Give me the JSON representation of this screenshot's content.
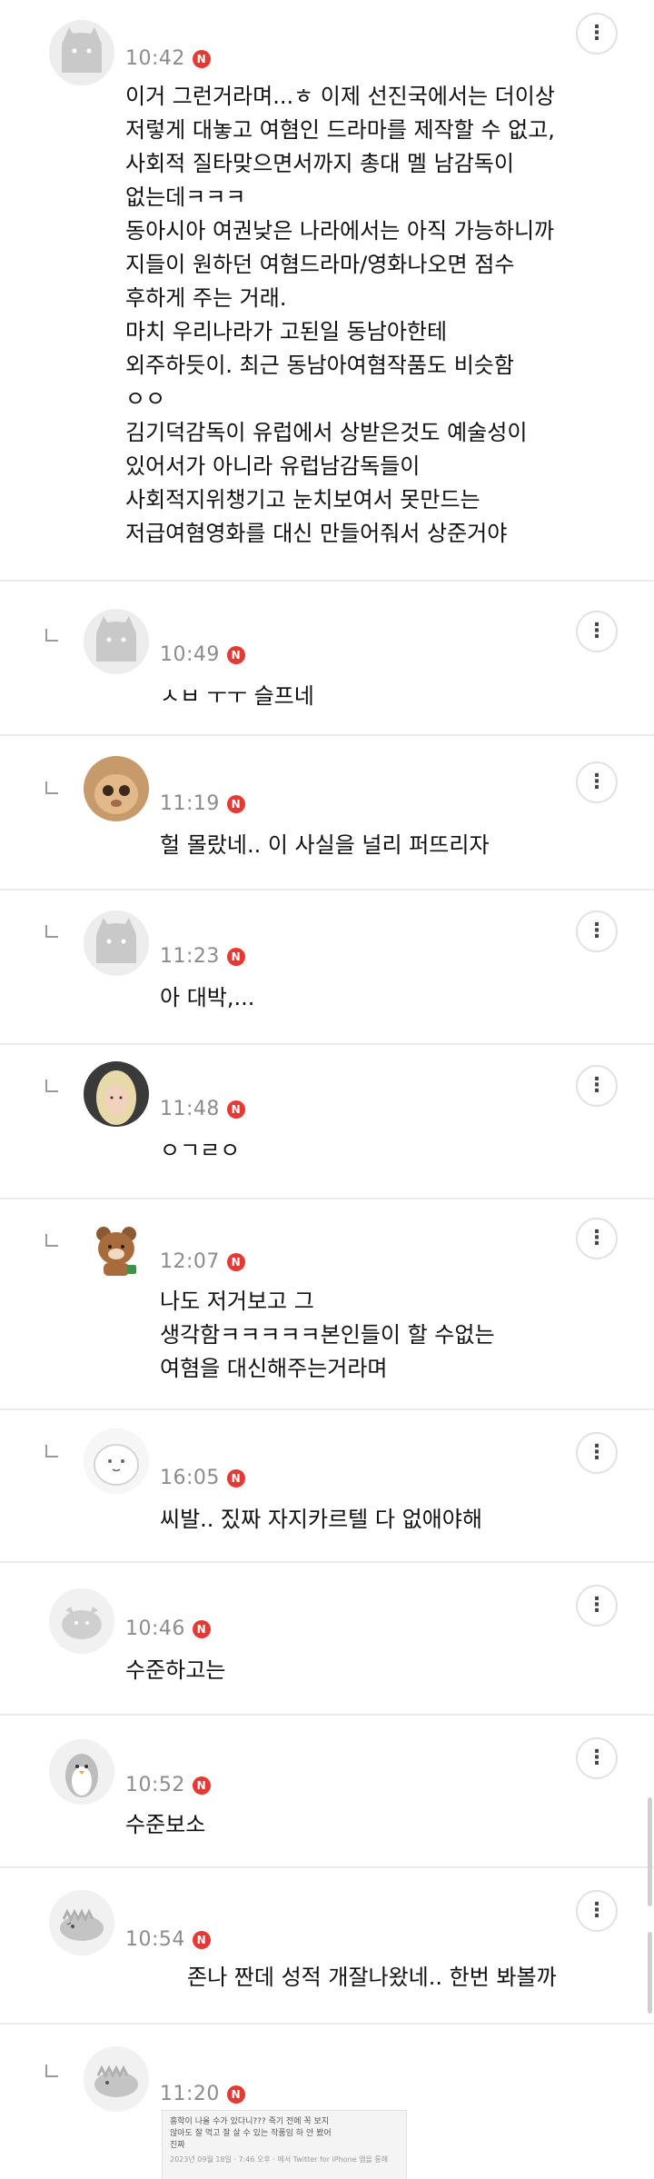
{
  "comments": [
    {
      "time": "10:42",
      "avatar": "cat-ghost-avatar",
      "text": "이거 그런거라며...ㅎ 이제 선진국에서는 더이상\n저렇게 대놓고 여혐인 드라마를 제작할 수 없고,\n사회적 질타맞으면서까지 총대 멜 남감독이\n없는데ㅋㅋㅋ\n동아시아 여권낮은 나라에서는 아직 가능하니까\n지들이 원하던 여혐드라마/영화나오면 점수\n후하게 주는 거래.\n마치 우리나라가 고된일 동남아한테\n외주하듯이. 최근 동남아여혐작품도 비슷함\nㅇㅇ\n김기덕감독이 유럽에서 상받은것도 예술성이\n있어서가 아니라 유럽남감독들이\n사회적지위챙기고 눈치보여서 못만드는\n저급여혐영화를 대신 만들어줘서 상준거야"
    },
    {
      "time": "10:49",
      "avatar": "cat-ghost-avatar",
      "text": "ㅅㅂ ㅜㅜ 슬프네"
    },
    {
      "time": "11:19",
      "avatar": "cat-photo-avatar",
      "text": "헐 몰랐네.. 이 사실을 널리 퍼뜨리자"
    },
    {
      "time": "11:23",
      "avatar": "cat-ghost-avatar",
      "text": "아 대박,..."
    },
    {
      "time": "11:48",
      "avatar": "blonde-person-avatar",
      "text": "ㅇㄱㄹㅇ"
    },
    {
      "time": "12:07",
      "avatar": "bear-avatar",
      "text": "나도 저거보고 그\n생각함ㅋㅋㅋㅋㅋ본인들이 할 수없는\n여혐을 대신해주는거라며"
    },
    {
      "time": "16:05",
      "avatar": "blob-avatar",
      "text": "씨발.. 짔짜 자지카르텔 다 없애야해"
    },
    {
      "time": "10:46",
      "avatar": "fish-avatar",
      "text": "수준하고는"
    },
    {
      "time": "10:52",
      "avatar": "penguin-avatar",
      "text": "수준보소"
    },
    {
      "time": "10:54",
      "avatar": "dino-avatar",
      "text": "존나 짠데 성적 개잘나왔네.. 한번 봐볼까"
    },
    {
      "time": "11:20",
      "avatar": "dino-avatar",
      "text": ""
    }
  ],
  "embed_text": "흥학이 나올 수가 있다니??? 죽기 전에 꼭 보지\n않아도 잘 먹고 잘 살 수 있는 작품임 하 안 봤어\n진짜",
  "embed_footer": "2023년 09월 18일 · 7:46 오후 · 에서 Twitter for iPhone 앱을 통해",
  "badge_letter": "N",
  "more_icon": "⋮",
  "colors": {
    "badge": "#e53935",
    "divider": "#ebebeb",
    "time": "#8c8c8c"
  }
}
